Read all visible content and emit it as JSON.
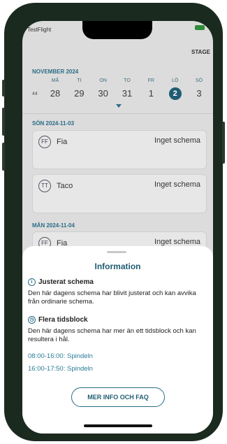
{
  "status": {
    "app": "TestFlight"
  },
  "header": {
    "stage": "STAGE"
  },
  "calendar": {
    "month": "NOVEMBER 2024",
    "week": "44",
    "days": [
      {
        "name": "MÅ",
        "num": "28"
      },
      {
        "name": "TI",
        "num": "29"
      },
      {
        "name": "ON",
        "num": "30"
      },
      {
        "name": "TO",
        "num": "31"
      },
      {
        "name": "FR",
        "num": "1"
      },
      {
        "name": "LÖ",
        "num": "2"
      },
      {
        "name": "SÖ",
        "num": "3"
      }
    ]
  },
  "schedule": {
    "date1": "SÖN 2024-11-03",
    "card1": {
      "initials": "FF",
      "name": "Fia",
      "status": "Inget schema"
    },
    "card2": {
      "initials": "TT",
      "name": "Taco",
      "status": "Inget schema"
    },
    "date2": "MÅN 2024-11-04",
    "card3": {
      "initials": "FF",
      "name": "Fia",
      "status": "Inget schema"
    }
  },
  "sheet": {
    "title": "Information",
    "adjusted": {
      "heading": "Justerat schema",
      "text": "Den här dagens schema har blivit justerat och kan avvika från ordinarie schema."
    },
    "multi": {
      "heading": "Flera tidsblock",
      "text": "Den här dagens schema har mer än ett tidsblock och kan resultera i hål."
    },
    "times": [
      "08:00-16:00: Spindeln",
      "16:00-17:50: Spindeln"
    ],
    "faq": "MER INFO OCH FAQ"
  }
}
